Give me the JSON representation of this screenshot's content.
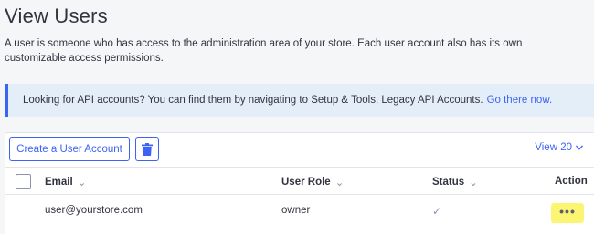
{
  "page": {
    "title": "View Users",
    "description": "A user is someone who has access to the administration area of your store. Each user account also has its own customizable access permissions."
  },
  "notice": {
    "text": "Looking for API accounts? You can find them by navigating to Setup & Tools, Legacy API Accounts.",
    "link": "Go there now.",
    "accent_color": "#3c64f4",
    "background": "#e4eef9"
  },
  "toolbar": {
    "create_label": "Create a User Account",
    "delete_icon": "trash-icon",
    "view_label": "View 20"
  },
  "table": {
    "columns": [
      "Email",
      "User Role",
      "Status",
      "Action"
    ],
    "rows": [
      {
        "email": "user@yourstore.com",
        "role": "owner",
        "status": "✓",
        "action": "•••"
      }
    ]
  },
  "colors": {
    "brand": "#3c64f4",
    "action_highlight": "#fbf571"
  }
}
